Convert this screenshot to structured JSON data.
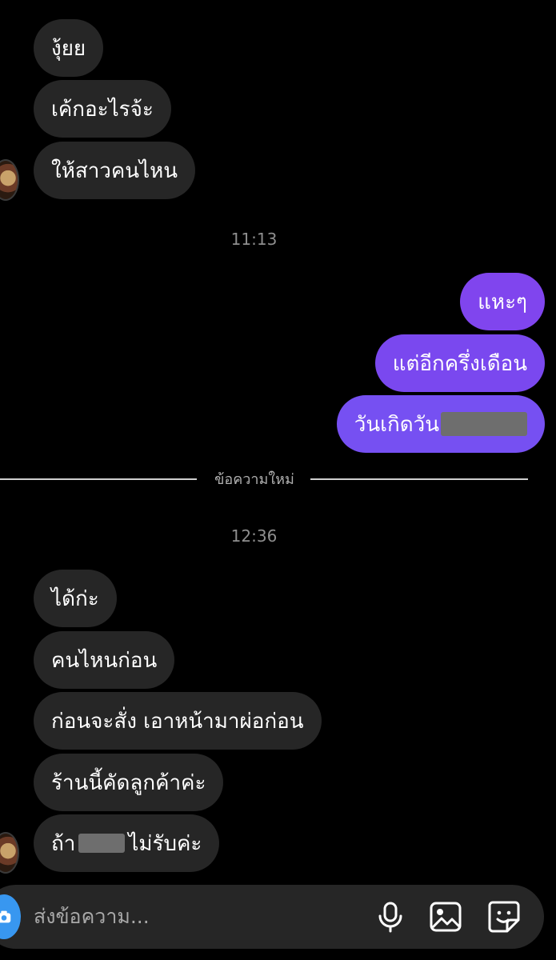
{
  "messages_top": [
    {
      "text": "งุ้ยย"
    },
    {
      "text": "เค้กอะไรจ้ะ"
    },
    {
      "text": "ให้สาวคนไหน"
    }
  ],
  "time_1": "11:13",
  "messages_sent": [
    {
      "text": "แหะๆ"
    },
    {
      "text": "แต่อีกครึ่งเดือน"
    },
    {
      "text": "วันเกิดวัน"
    }
  ],
  "new_messages_label": "ข้อความใหม่",
  "time_2": "12:36",
  "messages_bottom": [
    {
      "text": "ได้ก่ะ"
    },
    {
      "text": "คนไหนก่อน"
    },
    {
      "text": "ก่อนจะสั่ง เอาหน้ามาผ่อก่อน"
    },
    {
      "text": "ร้านนี้คัดลูกค้าค่ะ"
    },
    {
      "text_before": "ถ้า",
      "text_after": "ไม่รับค่ะ"
    }
  ],
  "composer": {
    "placeholder": "ส่งข้อความ...",
    "icons": [
      "camera-icon",
      "microphone-icon",
      "image-icon",
      "sticker-icon"
    ]
  },
  "colors": {
    "background": "#000000",
    "incoming_bubble": "#262626",
    "outgoing_gradient_start": "#7a4cf0",
    "outgoing_gradient_end": "#9a46e8",
    "timestamp": "#8e8e8e",
    "camera_button": "#3897f0"
  }
}
